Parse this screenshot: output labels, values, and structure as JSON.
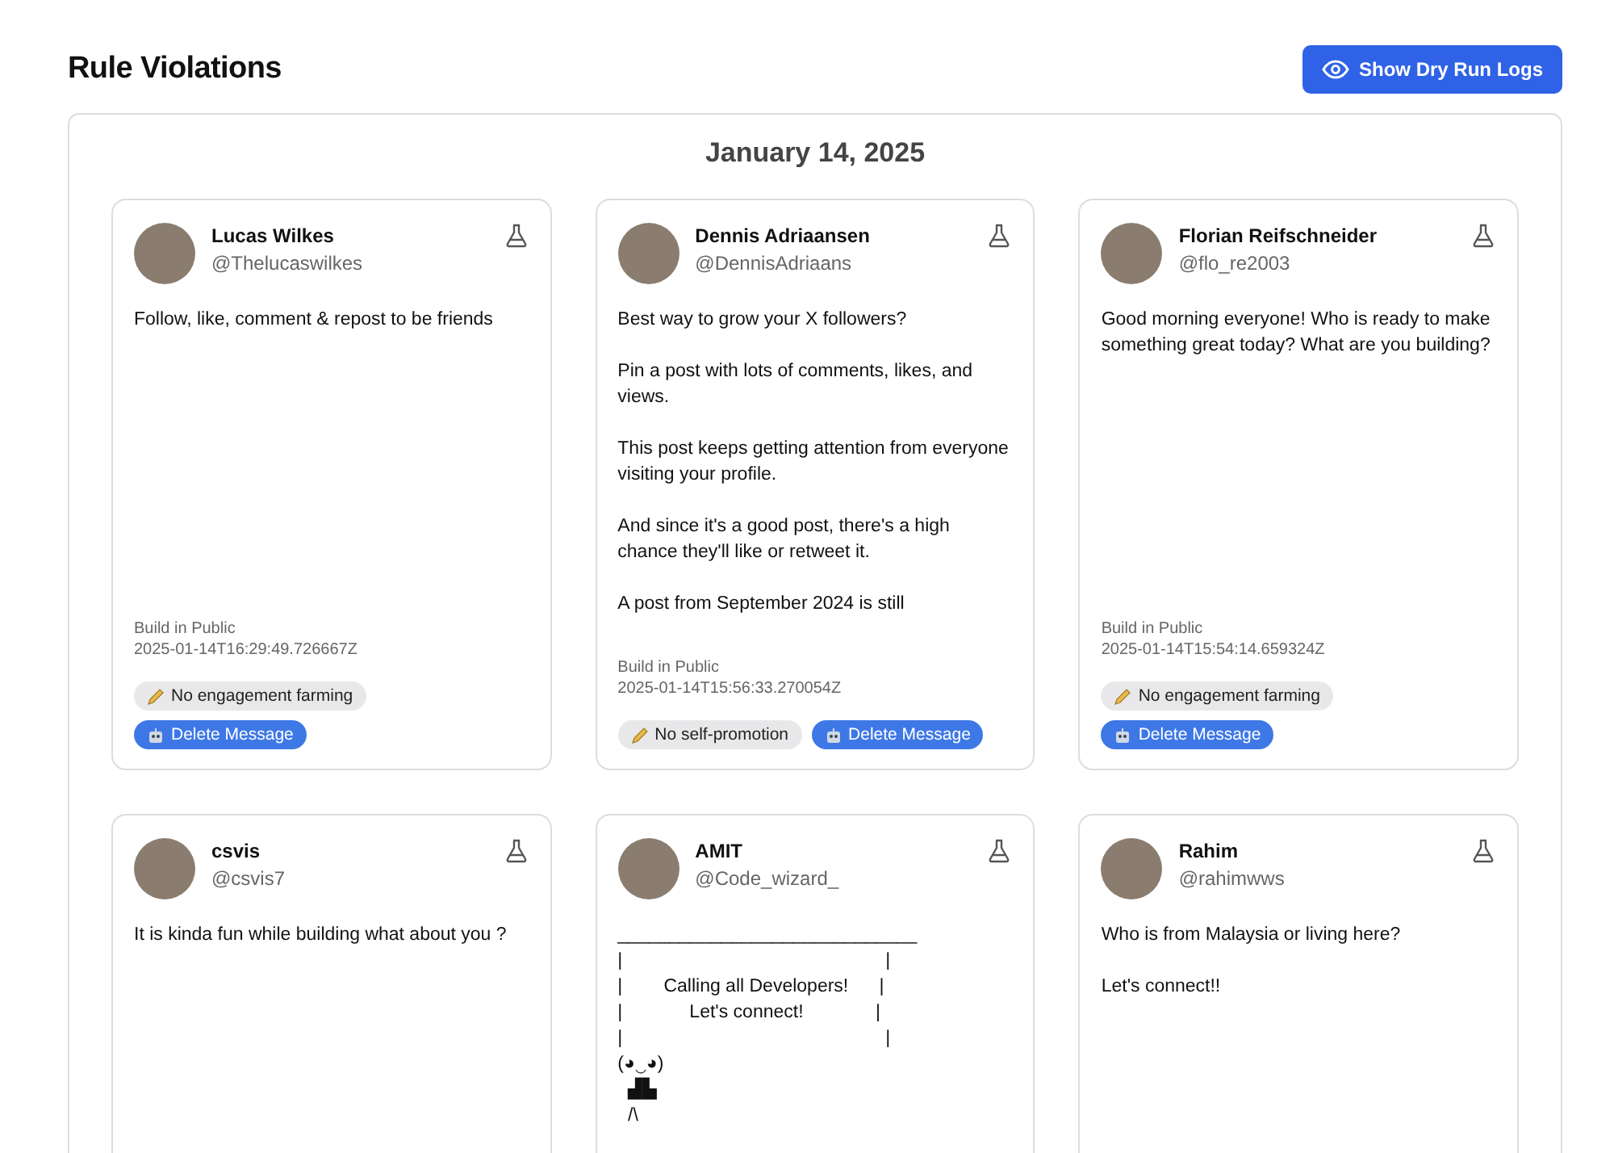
{
  "page_title": "Rule Violations",
  "dry_run_button": {
    "label": "Show Dry Run Logs"
  },
  "groups": [
    {
      "date": "January 14, 2025",
      "posts": [
        {
          "name": "Lucas Wilkes",
          "handle": "@Thelucaswilkes",
          "text": "Follow, like, comment & repost to be friends",
          "community": "Build in Public",
          "timestamp": "2025-01-14T16:29:49.726667Z",
          "violations": [
            "No engagement farming"
          ],
          "action": "Delete Message"
        },
        {
          "name": "Dennis Adriaansen",
          "handle": "@DennisAdriaans",
          "text": "Best way to grow your X followers?\n\nPin a post with lots of comments, likes, and views.\n\nThis post keeps getting attention from everyone visiting your profile.\n\nAnd since it's a good post, there's a high chance they'll like or retweet it.\n\nA post from September 2024 is still",
          "community": "Build in Public",
          "timestamp": "2025-01-14T15:56:33.270054Z",
          "violations": [
            "No self-promotion"
          ],
          "action": "Delete Message"
        },
        {
          "name": "Florian Reifschneider",
          "handle": "@flo_re2003",
          "text": "Good morning everyone! Who is ready to make something great today? What are you building?",
          "community": "Build in Public",
          "timestamp": "2025-01-14T15:54:14.659324Z",
          "violations": [
            "No engagement farming"
          ],
          "action": "Delete Message"
        },
        {
          "name": "csvis",
          "handle": "@csvis7",
          "text": "It is kinda fun while building what about you ?"
        },
        {
          "name": "AMIT",
          "handle": "@Code_wizard_",
          "text": "_____________________________\n|                                                   |\n|        Calling all Developers!      |\n|             Let's connect!              |\n|                                                   |\n(◕‿◕)\n  ▟▙\n  /\\"
        },
        {
          "name": "Rahim",
          "handle": "@rahimwws",
          "text": "Who is from Malaysia or living here?\n\nLet's connect!!"
        }
      ]
    }
  ]
}
